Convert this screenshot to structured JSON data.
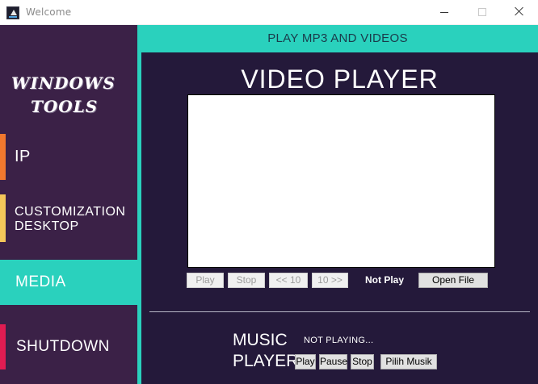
{
  "window": {
    "title": "Welcome",
    "controls": [
      "minimize",
      "maximize",
      "close"
    ]
  },
  "sidebar": {
    "brand_line1": "WINDOWS",
    "brand_line2": "TOOLS",
    "items": [
      {
        "label": "IP",
        "accent": "#f1782e"
      },
      {
        "label": "CUSTOMIZATION DESKTOP",
        "accent": "#f4c75a"
      },
      {
        "label": "MEDIA",
        "active": true,
        "accent": "#2ad1bd"
      },
      {
        "label": "SHUTDOWN",
        "accent": "#e01c52"
      }
    ]
  },
  "header": {
    "title": "PLAY MP3 AND VIDEOS"
  },
  "video": {
    "title": "VIDEO PLAYER",
    "play_label": "Play",
    "stop_label": "Stop",
    "back_label": "<< 10",
    "forward_label": "10 >>",
    "status": "Not Play",
    "open_label": "Open File"
  },
  "music": {
    "title_line1": "MUSIC",
    "title_line2": "PLAYER",
    "status": "NOT PLAYING...",
    "play_label": "Play",
    "pause_label": "Pause",
    "stop_label": "Stop",
    "choose_label": "Pilih Musik"
  },
  "theme": {
    "sidebar_bg": "#3b2147",
    "content_bg": "#24193a",
    "accent_teal": "#2ad1bd"
  }
}
